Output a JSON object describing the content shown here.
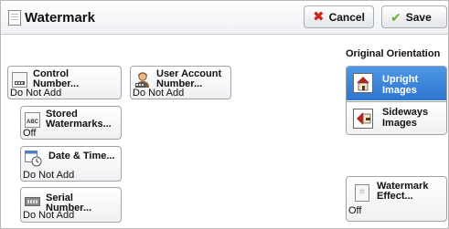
{
  "header": {
    "title": "Watermark",
    "cancel_label": "Cancel",
    "save_label": "Save"
  },
  "buttons": {
    "control_number": {
      "label1": "Control",
      "label2": "Number...",
      "value": "Do Not Add"
    },
    "user_account": {
      "label1": "User Account",
      "label2": "Number...",
      "value": "Do Not Add"
    },
    "stored_watermarks": {
      "label1": "Stored",
      "label2": "Watermarks...",
      "value": "Off"
    },
    "date_time": {
      "label": "Date & Time...",
      "value": "Do Not Add"
    },
    "serial_number": {
      "label": "Serial Number...",
      "value": "Do Not Add"
    },
    "watermark_effect": {
      "label1": "Watermark",
      "label2": "Effect...",
      "value": "Off"
    }
  },
  "orientation": {
    "heading": "Original Orientation",
    "upright_label": "Upright Images",
    "sideways_label1": "Sideways",
    "sideways_label2": "Images",
    "selected": "Upright Images"
  },
  "icon_text": {
    "stored_watermarks": "ABC"
  },
  "colors": {
    "accent": "#3a82d8",
    "cancel": "#d0231c",
    "save": "#65b02a"
  },
  "icons": {
    "title": "document-icon",
    "cancel": "x-icon",
    "save": "check-icon",
    "control_number": "counter-icon",
    "user_account": "user-icon",
    "stored_watermarks": "stamp-icon",
    "date_time": "calendar-clock-icon",
    "serial_number": "serial-icon",
    "watermark_effect": "watermark-icon",
    "upright": "upright-house-icon",
    "sideways": "sideways-house-icon"
  }
}
